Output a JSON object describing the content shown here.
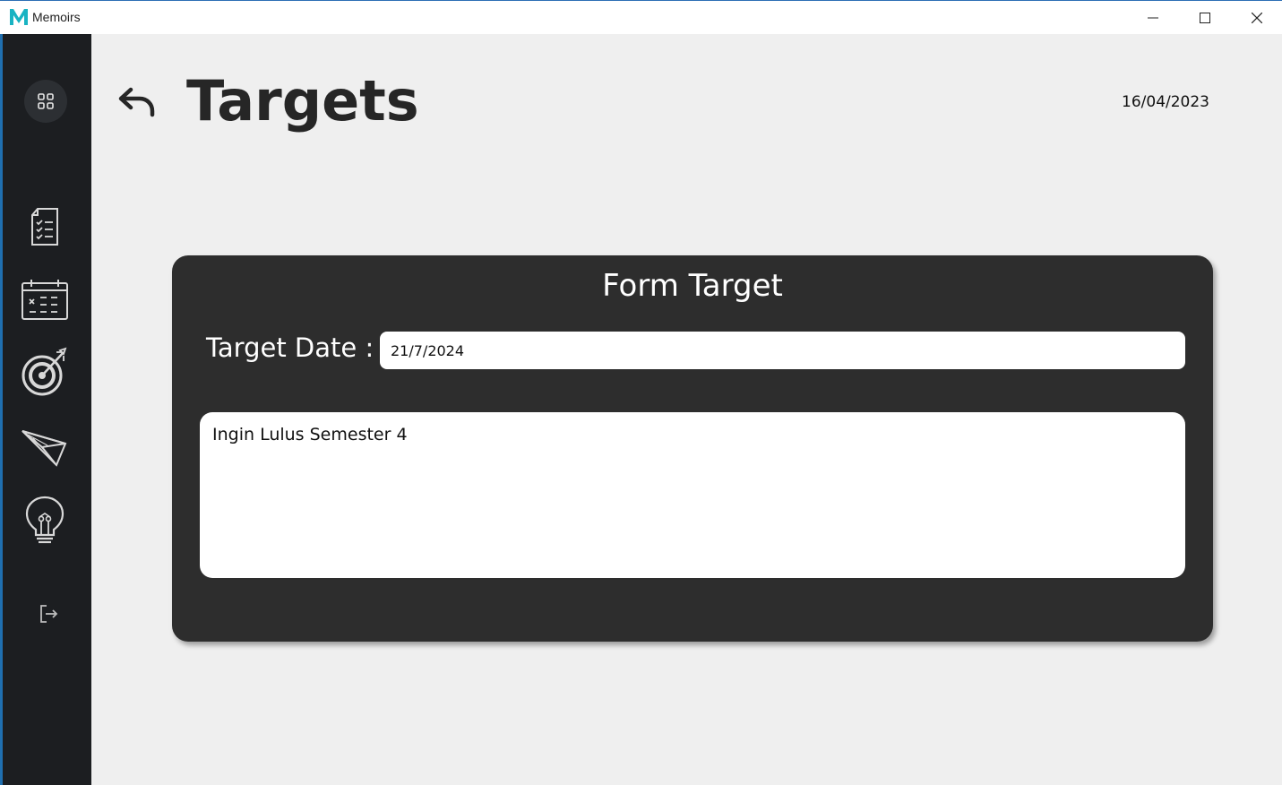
{
  "window": {
    "title": "Memoirs",
    "logo_letter": "M",
    "logo_color": "#19b3c2"
  },
  "sidebar": {
    "background": "#1c1e21",
    "items": [
      {
        "icon": "grid-icon"
      },
      {
        "icon": "checklist-icon"
      },
      {
        "icon": "calendar-icon"
      },
      {
        "icon": "target-icon"
      },
      {
        "icon": "paper-plane-icon"
      },
      {
        "icon": "lightbulb-icon"
      },
      {
        "icon": "logout-icon"
      }
    ]
  },
  "header": {
    "title": "Targets",
    "date": "16/04/2023"
  },
  "form": {
    "title": "Form Target",
    "date_label": "Target Date :",
    "date_value": "21/7/2024",
    "note_value": "Ingin Lulus Semester 4"
  }
}
